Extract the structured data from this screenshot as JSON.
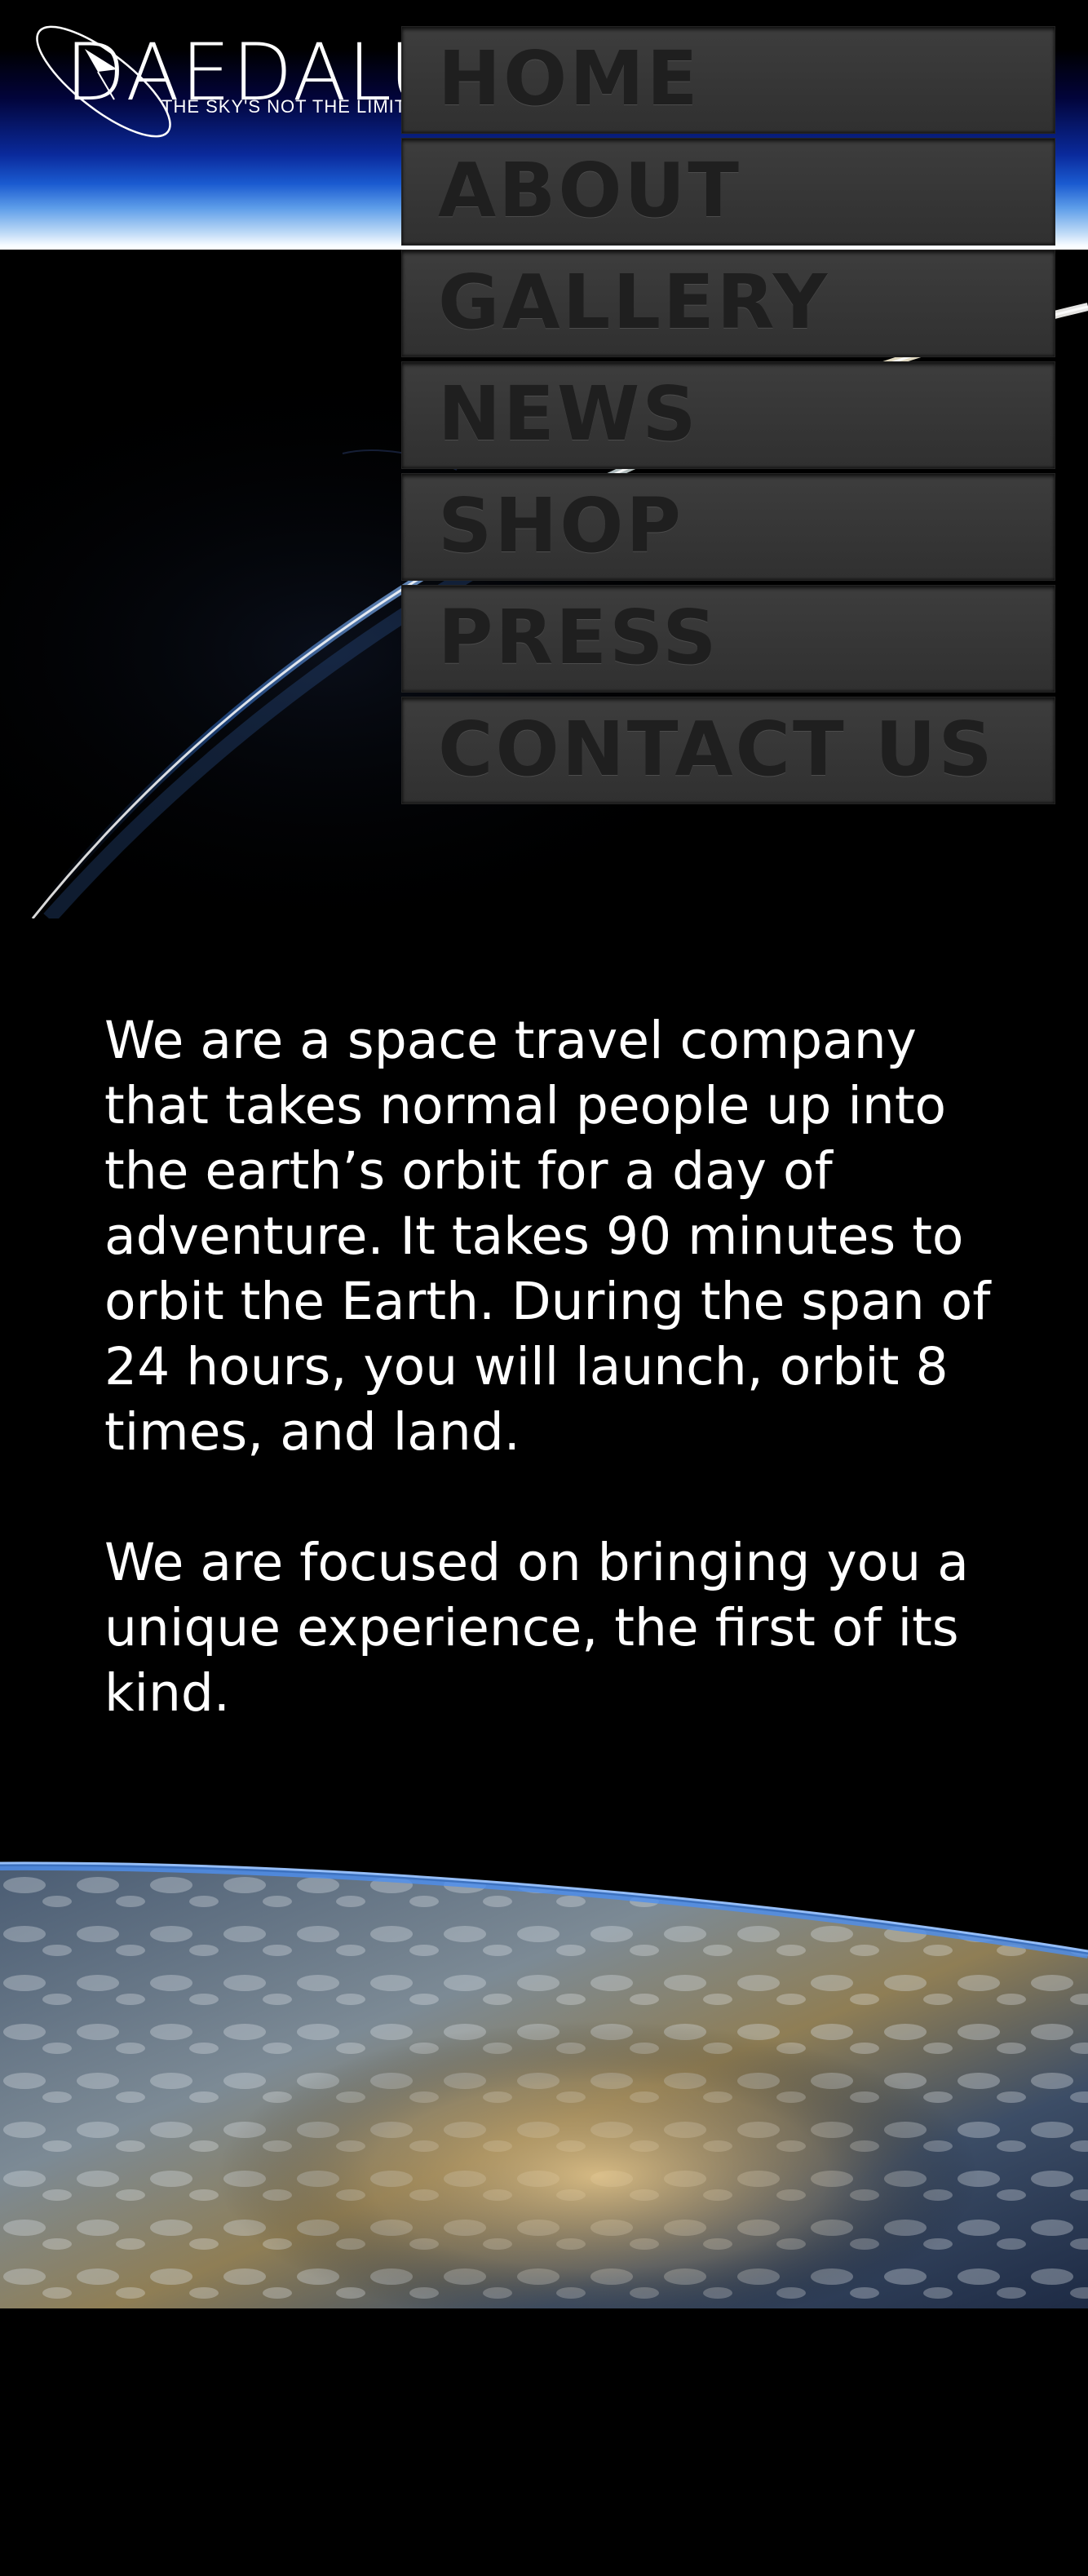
{
  "header": {
    "logo_text": "DAEDALUS",
    "tagline": "THE SKY'S NOT THE LIMIT",
    "menu_icon": "hamburger-icon"
  },
  "nav": {
    "items": [
      {
        "label": "HOME"
      },
      {
        "label": "ABOUT"
      },
      {
        "label": "GALLERY"
      },
      {
        "label": "NEWS"
      },
      {
        "label": "SHOP"
      },
      {
        "label": "PRESS"
      },
      {
        "label": "CONTACT US"
      }
    ]
  },
  "intro": {
    "paragraphs": [
      "We are a space travel company that takes normal people up into the earth’s orbit for a day of adventure. It takes 90 minutes to orbit the Earth. During the span of 24 hours, you will launch, orbit 8 times, and land.",
      "We are focused on bringing you a unique experience, the first of its kind."
    ]
  },
  "colors": {
    "background": "#000000",
    "text": "#ffffff",
    "nav_item_bg": "#363636",
    "nav_item_text": "#1f1f1f",
    "menu_icon": "#cfcfcf"
  }
}
